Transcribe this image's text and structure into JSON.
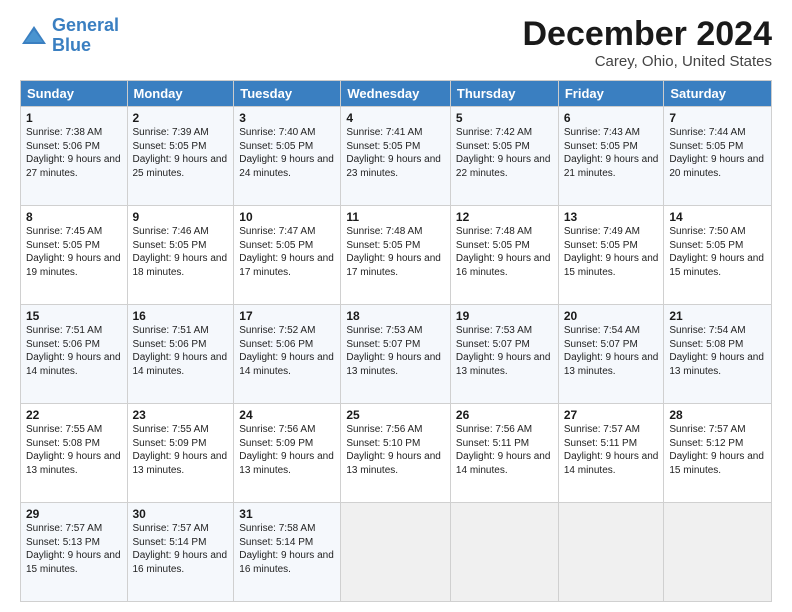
{
  "logo": {
    "line1": "General",
    "line2": "Blue"
  },
  "title": "December 2024",
  "location": "Carey, Ohio, United States",
  "days_header": [
    "Sunday",
    "Monday",
    "Tuesday",
    "Wednesday",
    "Thursday",
    "Friday",
    "Saturday"
  ],
  "weeks": [
    [
      {
        "num": "1",
        "sr": "7:38 AM",
        "ss": "5:06 PM",
        "dl": "9 hours and 27 minutes."
      },
      {
        "num": "2",
        "sr": "7:39 AM",
        "ss": "5:05 PM",
        "dl": "9 hours and 25 minutes."
      },
      {
        "num": "3",
        "sr": "7:40 AM",
        "ss": "5:05 PM",
        "dl": "9 hours and 24 minutes."
      },
      {
        "num": "4",
        "sr": "7:41 AM",
        "ss": "5:05 PM",
        "dl": "9 hours and 23 minutes."
      },
      {
        "num": "5",
        "sr": "7:42 AM",
        "ss": "5:05 PM",
        "dl": "9 hours and 22 minutes."
      },
      {
        "num": "6",
        "sr": "7:43 AM",
        "ss": "5:05 PM",
        "dl": "9 hours and 21 minutes."
      },
      {
        "num": "7",
        "sr": "7:44 AM",
        "ss": "5:05 PM",
        "dl": "9 hours and 20 minutes."
      }
    ],
    [
      {
        "num": "8",
        "sr": "7:45 AM",
        "ss": "5:05 PM",
        "dl": "9 hours and 19 minutes."
      },
      {
        "num": "9",
        "sr": "7:46 AM",
        "ss": "5:05 PM",
        "dl": "9 hours and 18 minutes."
      },
      {
        "num": "10",
        "sr": "7:47 AM",
        "ss": "5:05 PM",
        "dl": "9 hours and 17 minutes."
      },
      {
        "num": "11",
        "sr": "7:48 AM",
        "ss": "5:05 PM",
        "dl": "9 hours and 17 minutes."
      },
      {
        "num": "12",
        "sr": "7:48 AM",
        "ss": "5:05 PM",
        "dl": "9 hours and 16 minutes."
      },
      {
        "num": "13",
        "sr": "7:49 AM",
        "ss": "5:05 PM",
        "dl": "9 hours and 15 minutes."
      },
      {
        "num": "14",
        "sr": "7:50 AM",
        "ss": "5:05 PM",
        "dl": "9 hours and 15 minutes."
      }
    ],
    [
      {
        "num": "15",
        "sr": "7:51 AM",
        "ss": "5:06 PM",
        "dl": "9 hours and 14 minutes."
      },
      {
        "num": "16",
        "sr": "7:51 AM",
        "ss": "5:06 PM",
        "dl": "9 hours and 14 minutes."
      },
      {
        "num": "17",
        "sr": "7:52 AM",
        "ss": "5:06 PM",
        "dl": "9 hours and 14 minutes."
      },
      {
        "num": "18",
        "sr": "7:53 AM",
        "ss": "5:07 PM",
        "dl": "9 hours and 13 minutes."
      },
      {
        "num": "19",
        "sr": "7:53 AM",
        "ss": "5:07 PM",
        "dl": "9 hours and 13 minutes."
      },
      {
        "num": "20",
        "sr": "7:54 AM",
        "ss": "5:07 PM",
        "dl": "9 hours and 13 minutes."
      },
      {
        "num": "21",
        "sr": "7:54 AM",
        "ss": "5:08 PM",
        "dl": "9 hours and 13 minutes."
      }
    ],
    [
      {
        "num": "22",
        "sr": "7:55 AM",
        "ss": "5:08 PM",
        "dl": "9 hours and 13 minutes."
      },
      {
        "num": "23",
        "sr": "7:55 AM",
        "ss": "5:09 PM",
        "dl": "9 hours and 13 minutes."
      },
      {
        "num": "24",
        "sr": "7:56 AM",
        "ss": "5:09 PM",
        "dl": "9 hours and 13 minutes."
      },
      {
        "num": "25",
        "sr": "7:56 AM",
        "ss": "5:10 PM",
        "dl": "9 hours and 13 minutes."
      },
      {
        "num": "26",
        "sr": "7:56 AM",
        "ss": "5:11 PM",
        "dl": "9 hours and 14 minutes."
      },
      {
        "num": "27",
        "sr": "7:57 AM",
        "ss": "5:11 PM",
        "dl": "9 hours and 14 minutes."
      },
      {
        "num": "28",
        "sr": "7:57 AM",
        "ss": "5:12 PM",
        "dl": "9 hours and 15 minutes."
      }
    ],
    [
      {
        "num": "29",
        "sr": "7:57 AM",
        "ss": "5:13 PM",
        "dl": "9 hours and 15 minutes."
      },
      {
        "num": "30",
        "sr": "7:57 AM",
        "ss": "5:14 PM",
        "dl": "9 hours and 16 minutes."
      },
      {
        "num": "31",
        "sr": "7:58 AM",
        "ss": "5:14 PM",
        "dl": "9 hours and 16 minutes."
      },
      null,
      null,
      null,
      null
    ]
  ],
  "labels": {
    "sunrise": "Sunrise:",
    "sunset": "Sunset:",
    "daylight": "Daylight:"
  }
}
